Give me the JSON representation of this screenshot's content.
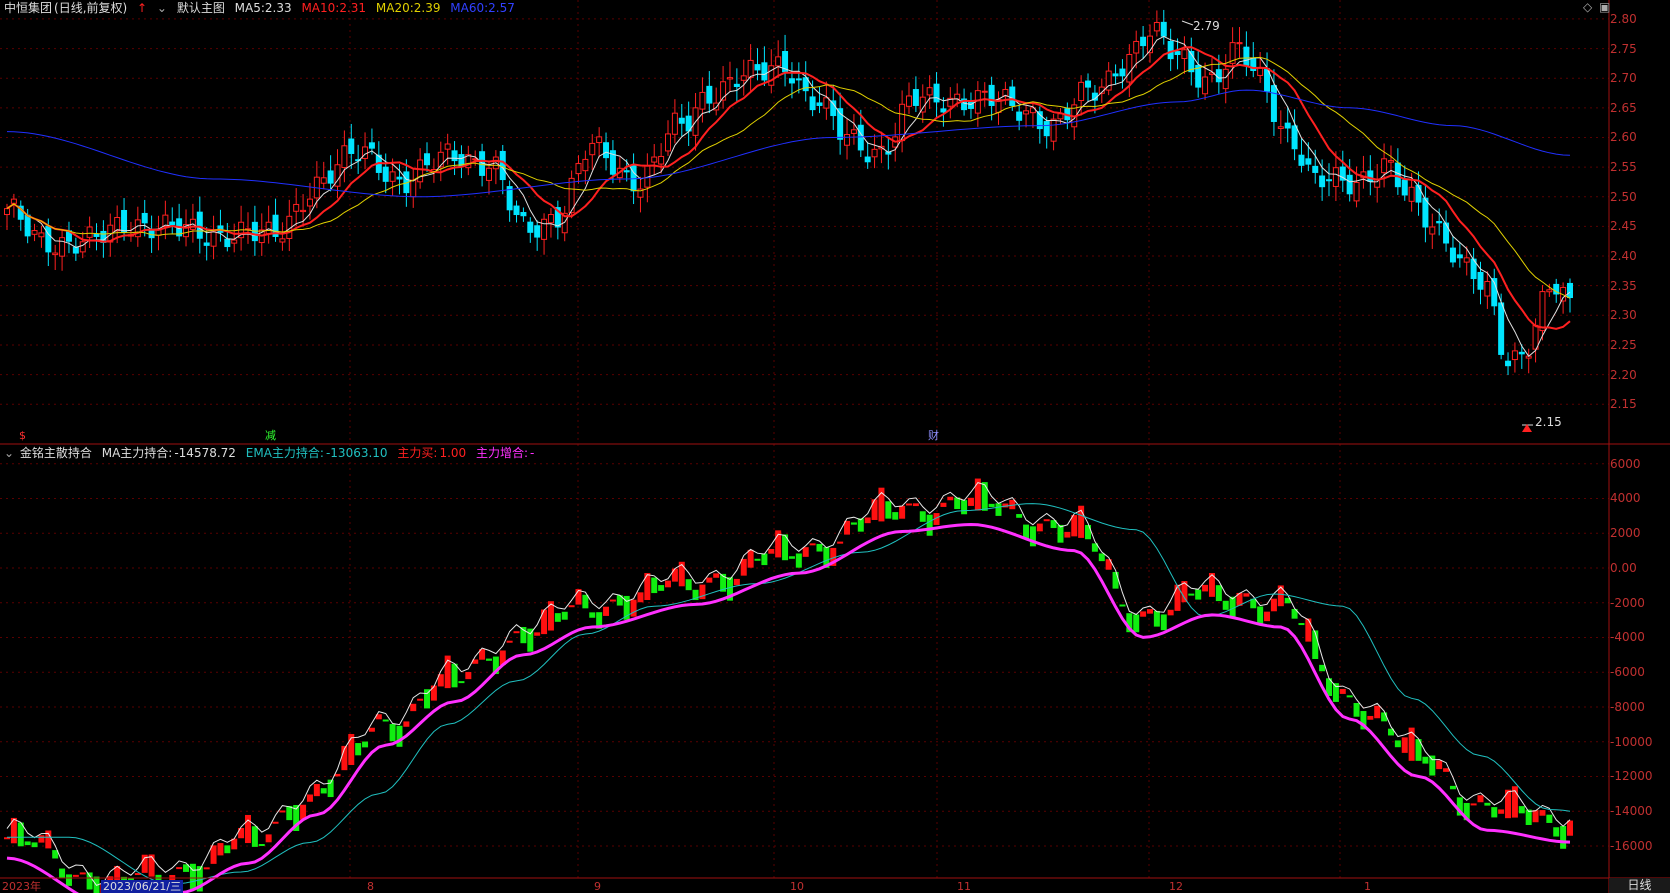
{
  "header_main": {
    "stock_name": "中恒集团",
    "mode": "(日线,前复权)",
    "template": "默认主图",
    "ma5": {
      "label": "MA5:",
      "value": "2.33",
      "color": "#e0e0e0"
    },
    "ma10": {
      "label": "MA10:",
      "value": "2.31",
      "color": "#ff2020"
    },
    "ma20": {
      "label": "MA20:",
      "value": "2.39",
      "color": "#e0d000"
    },
    "ma60": {
      "label": "MA60:",
      "value": "2.57",
      "color": "#2030ff"
    }
  },
  "header_sub": {
    "indicator": "金铭主散持合",
    "ma_label": "MA主力持合:",
    "ma_value": "-14578.72",
    "ema_label": "EMA主力持合:",
    "ema_value": "-13063.10",
    "buy_label": "主力买:",
    "buy_value": "1.00",
    "add_label": "主力增合:",
    "add_value": "-"
  },
  "event_markers": [
    {
      "label": "$",
      "color": "#ff3030"
    },
    {
      "label": "减",
      "color": "#30ff30"
    },
    {
      "label": "财",
      "color": "#8080ff"
    }
  ],
  "annotations": {
    "high": "2.79",
    "low": "2.15"
  },
  "x_axis": {
    "labels": [
      "2023年",
      "2023/06/21/三",
      "8",
      "9",
      "10",
      "11",
      "12",
      "1"
    ],
    "period": "日线"
  },
  "colors": {
    "up": "#ff2020",
    "down": "#00e5ff",
    "bar_up": "#ff1010",
    "bar_down": "#10ee10",
    "grid": "#5a0000",
    "axis": "#a01010"
  },
  "chart_data": [
    {
      "type": "candlestick",
      "title": "中恒集团 (日线,前复权)",
      "ylim": [
        2.12,
        2.81
      ],
      "y_ticks": [
        "2.80",
        "2.75",
        "2.70",
        "2.65",
        "2.60",
        "2.55",
        "2.50",
        "2.45",
        "2.40",
        "2.35",
        "2.30",
        "2.25",
        "2.20",
        "2.15"
      ],
      "close_anchors": [
        [
          0,
          2.47
        ],
        [
          5,
          2.43
        ],
        [
          12,
          2.42
        ],
        [
          18,
          2.46
        ],
        [
          25,
          2.44
        ],
        [
          32,
          2.44
        ],
        [
          38,
          2.43
        ],
        [
          45,
          2.52
        ],
        [
          52,
          2.58
        ],
        [
          58,
          2.52
        ],
        [
          65,
          2.58
        ],
        [
          70,
          2.55
        ],
        [
          75,
          2.45
        ],
        [
          80,
          2.47
        ],
        [
          85,
          2.58
        ],
        [
          92,
          2.53
        ],
        [
          98,
          2.62
        ],
        [
          102,
          2.68
        ],
        [
          108,
          2.7
        ],
        [
          113,
          2.73
        ],
        [
          117,
          2.66
        ],
        [
          122,
          2.6
        ],
        [
          127,
          2.58
        ],
        [
          132,
          2.66
        ],
        [
          137,
          2.67
        ],
        [
          142,
          2.66
        ],
        [
          148,
          2.65
        ],
        [
          152,
          2.62
        ],
        [
          158,
          2.68
        ],
        [
          162,
          2.73
        ],
        [
          166,
          2.77
        ],
        [
          170,
          2.74
        ],
        [
          175,
          2.7
        ],
        [
          179,
          2.74
        ],
        [
          182,
          2.7
        ],
        [
          186,
          2.61
        ],
        [
          190,
          2.52
        ],
        [
          195,
          2.53
        ],
        [
          200,
          2.55
        ],
        [
          204,
          2.49
        ],
        [
          208,
          2.45
        ],
        [
          212,
          2.38
        ],
        [
          215,
          2.33
        ],
        [
          218,
          2.22
        ],
        [
          221,
          2.26
        ],
        [
          224,
          2.35
        ],
        [
          227,
          2.31
        ]
      ],
      "ma60_anchors": [
        [
          0,
          2.61
        ],
        [
          30,
          2.53
        ],
        [
          60,
          2.5
        ],
        [
          90,
          2.53
        ],
        [
          120,
          2.6
        ],
        [
          150,
          2.62
        ],
        [
          170,
          2.66
        ],
        [
          180,
          2.68
        ],
        [
          195,
          2.65
        ],
        [
          210,
          2.62
        ],
        [
          227,
          2.57
        ]
      ],
      "last": {
        "ma5": 2.33,
        "ma10": 2.31,
        "ma20": 2.39,
        "ma60": 2.57
      }
    },
    {
      "type": "bar",
      "title": "金铭主散持合",
      "ylim": [
        -17500,
        6500
      ],
      "y_ticks": [
        "6000",
        "4000",
        "2000",
        "0.00",
        "-2000",
        "-4000",
        "-6000",
        "-8000",
        "-10000",
        "-12000",
        "-14000",
        "-16000"
      ],
      "ma_anchors": [
        [
          0,
          -15500
        ],
        [
          15,
          -18200
        ],
        [
          25,
          -17500
        ],
        [
          35,
          -15800
        ],
        [
          45,
          -13000
        ],
        [
          55,
          -9000
        ],
        [
          65,
          -6500
        ],
        [
          75,
          -3800
        ],
        [
          85,
          -2200
        ],
        [
          100,
          -900
        ],
        [
          115,
          900
        ],
        [
          130,
          3300
        ],
        [
          140,
          3700
        ],
        [
          155,
          2200
        ],
        [
          165,
          -2800
        ],
        [
          175,
          -1500
        ],
        [
          185,
          -2200
        ],
        [
          195,
          -7500
        ],
        [
          205,
          -10800
        ],
        [
          215,
          -13900
        ],
        [
          227,
          -14578.72
        ]
      ],
      "ema_last": -13063.1,
      "buy": 1.0
    }
  ]
}
